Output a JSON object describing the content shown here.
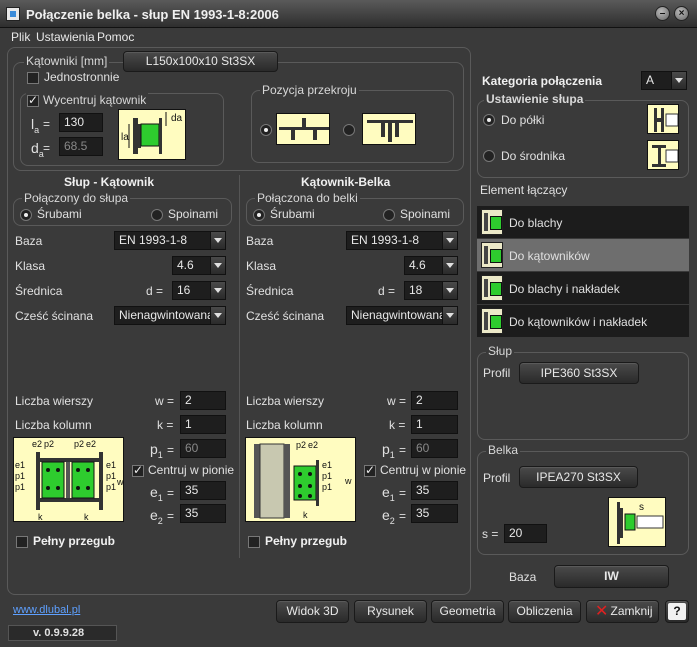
{
  "window": {
    "title": "Połączenie belka - słup  EN 1993-1-8:2006"
  },
  "menu": [
    "Plik",
    "Ustawienia",
    "Pomoc"
  ],
  "angles": {
    "group_title": "Kątowniki [mm]",
    "profile": "L150x100x10 St3SX",
    "one_side_label": "Jednostronnie",
    "one_side_checked": false,
    "center_label": "Wycentruj kątownik",
    "center_checked": true,
    "la_label": "l",
    "la_sub": "a",
    "la_eq": "=",
    "la_value": "130",
    "da_label": "d",
    "da_sub": "a",
    "da_eq": "=",
    "da_value": "68.5",
    "diag_la": "la",
    "diag_da": "da"
  },
  "section_position": {
    "title": "Pozycja przekroju",
    "selected": 0
  },
  "column_angle": {
    "header": "Słup - Kątownik",
    "connected_title": "Połączony do słupa",
    "bolts_label": "Śrubami",
    "welds_label": "Spoinami",
    "selected": "bolts",
    "base_label": "Baza",
    "base_value": "EN 1993-1-8",
    "class_label": "Klasa",
    "class_value": "4.6",
    "diam_label": "Średnica",
    "diam_eq": "d =",
    "diam_value": "16",
    "shear_label": "Cześć ścinana",
    "shear_value": "Nienagwintowana",
    "rows_label": "Liczba wierszy",
    "rows_eq": "w =",
    "rows_value": "2",
    "cols_label": "Liczba kolumn",
    "cols_eq": "k =",
    "cols_value": "1",
    "p1_label": "p",
    "p1_sub": "1",
    "p1_eq": "=",
    "p1_value": "60",
    "center_label": "Centruj w pionie",
    "center_checked": true,
    "e1_label": "e",
    "e1_sub": "1",
    "e1_eq": "=",
    "e1_value": "35",
    "e2_label": "e",
    "e2_sub": "2",
    "e2_eq": "=",
    "e2_value": "35",
    "hinge_label": "Pełny przegub",
    "hinge_checked": false,
    "diag": {
      "e2": "e2",
      "p2": "p2",
      "e1": "e1",
      "p1": "p1",
      "w": "w",
      "k": "k"
    }
  },
  "angle_beam": {
    "header": "Kątownik-Belka",
    "connected_title": "Połączona do belki",
    "bolts_label": "Śrubami",
    "welds_label": "Spoinami",
    "selected": "bolts",
    "base_label": "Baza",
    "base_value": "EN 1993-1-8",
    "class_label": "Klasa",
    "class_value": "4.6",
    "diam_label": "Średnica",
    "diam_eq": "d =",
    "diam_value": "18",
    "shear_label": "Cześć ścinana",
    "shear_value": "Nienagwintowana",
    "rows_label": "Liczba wierszy",
    "rows_eq": "w =",
    "rows_value": "2",
    "cols_label": "Liczba kolumn",
    "cols_eq": "k =",
    "cols_value": "1",
    "p1_label": "p",
    "p1_sub": "1",
    "p1_eq": "=",
    "p1_value": "60",
    "center_label": "Centruj w pionie",
    "center_checked": true,
    "e1_label": "e",
    "e1_sub": "1",
    "e1_eq": "=",
    "e1_value": "35",
    "e2_label": "e",
    "e2_sub": "2",
    "e2_eq": "=",
    "e2_value": "35",
    "hinge_label": "Pełny przegub",
    "hinge_checked": false,
    "diag": {
      "p2": "p2",
      "e2": "e2",
      "e1": "e1",
      "p1": "p1",
      "w": "w",
      "k": "k"
    }
  },
  "right": {
    "category_label": "Kategoria połączenia",
    "category_value": "A",
    "column_setting_title": "Ustawienie słupa",
    "to_flange_label": "Do półki",
    "to_web_label": "Do środnika",
    "column_setting_selected": "flange",
    "element_title": "Element łączący",
    "elements": [
      "Do blachy",
      "Do kątowników",
      "Do blachy i nakładek",
      "Do kątowników i nakładek"
    ],
    "element_selected": 1,
    "column_group": "Słup",
    "column_profile_label": "Profil",
    "column_profile": "IPE360 St3SX",
    "beam_group": "Belka",
    "beam_profile_label": "Profil",
    "beam_profile": "IPEA270 St3SX",
    "s_label": "s =",
    "s_value": "20",
    "s_diag": "s",
    "base_label": "Baza",
    "base_value": "IW"
  },
  "footer": {
    "link": "www.dlubal.pl",
    "version": "v. 0.9.9.28",
    "btn_3d": "Widok 3D",
    "btn_drawing": "Rysunek",
    "btn_geometry": "Geometria",
    "btn_calc": "Obliczenia",
    "btn_close": "Zamknij",
    "btn_help": "?"
  },
  "colors": {
    "background": "#3a3a3a",
    "diagram_fill": "#fffcc0",
    "bolt_green": "#2ecc2e",
    "link": "#5ea0ff",
    "close_x": "#e02020"
  }
}
